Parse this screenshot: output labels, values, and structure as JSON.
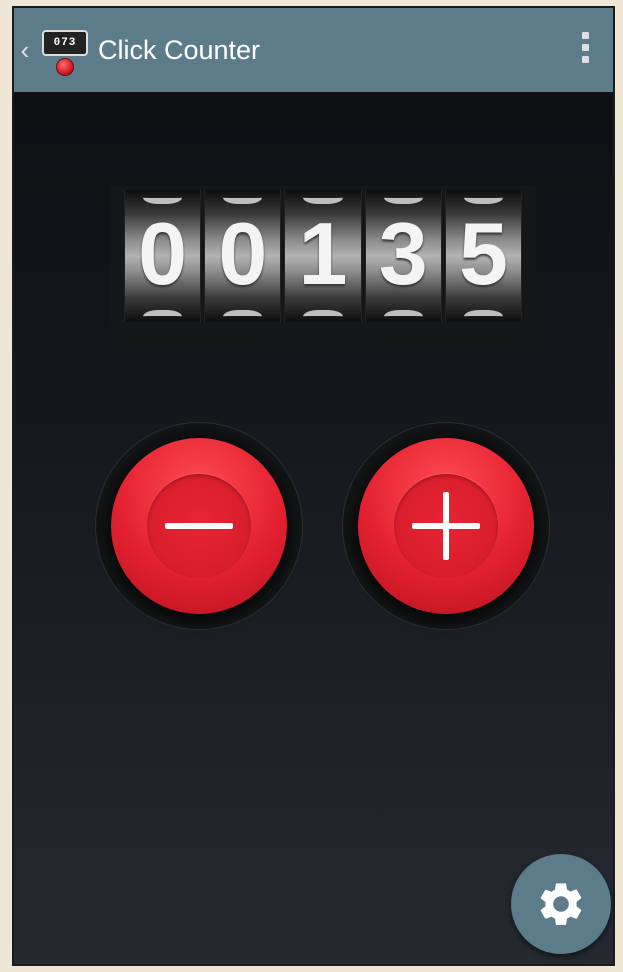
{
  "app_bar": {
    "title": "Click Counter",
    "back_icon": "chevron-left-icon",
    "app_icon_text": "073",
    "overflow_icon": "more-vert-icon"
  },
  "counter": {
    "digits": [
      "0",
      "0",
      "1",
      "3",
      "5"
    ]
  },
  "buttons": {
    "decrement_icon": "minus-icon",
    "increment_icon": "plus-icon"
  },
  "fab": {
    "icon": "gear-icon"
  },
  "colors": {
    "app_bar": "#5d7c89",
    "button_red": "#e32130"
  }
}
